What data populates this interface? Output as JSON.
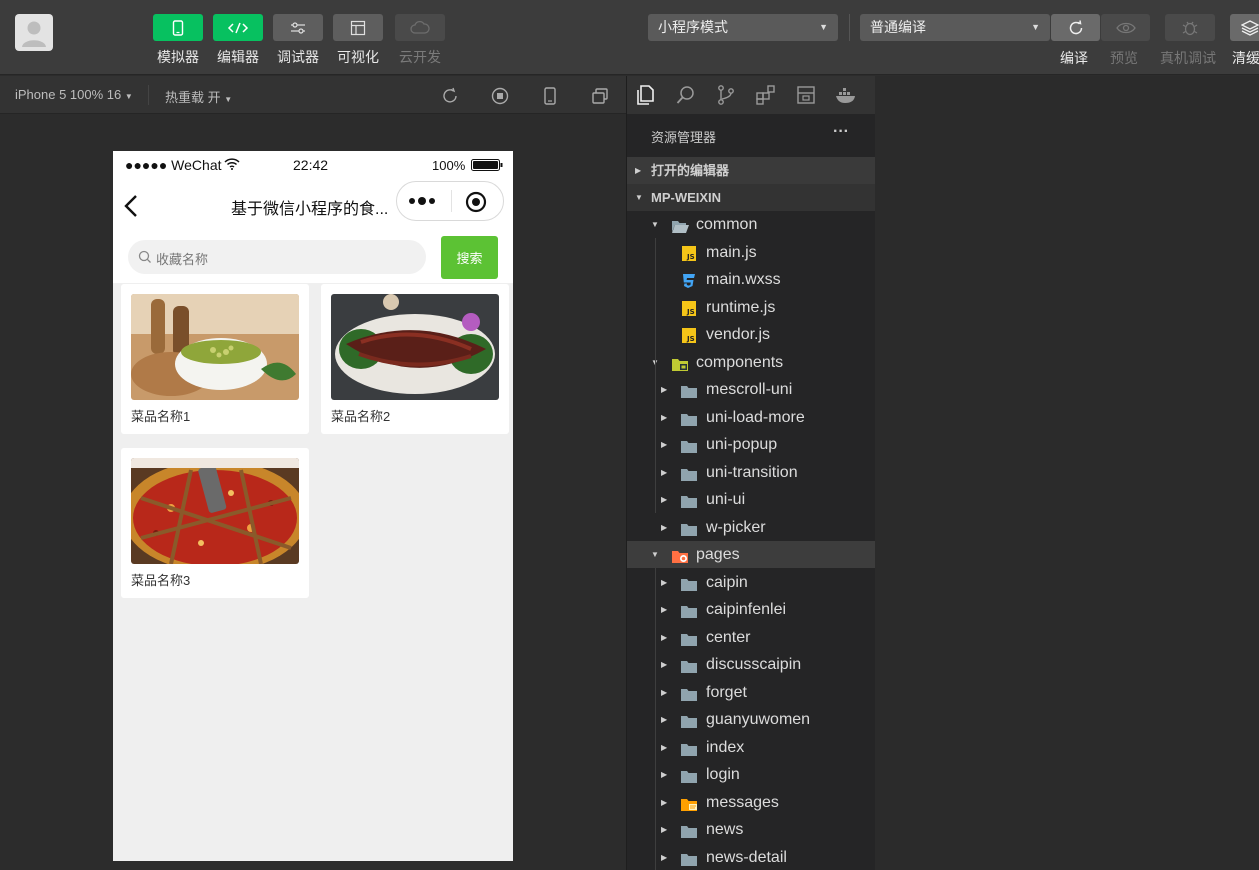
{
  "toolbar": {
    "simulator": "模拟器",
    "editor": "编辑器",
    "debugger": "调试器",
    "visual": "可视化",
    "cloud": "云开发",
    "mode_select": "小程序模式",
    "compile_select": "普通编译",
    "compile": "编译",
    "preview": "预览",
    "real_debug": "真机调试",
    "clear_cache": "清缓"
  },
  "simbar": {
    "device": "iPhone 5 100% 16",
    "hot_reload": "热重载 开"
  },
  "phone": {
    "status": {
      "carrier": "●●●●● WeChat",
      "time": "22:42",
      "battery": "100%"
    },
    "nav_title": "基于微信小程序的食...",
    "search_placeholder": "收藏名称",
    "search_button": "搜索",
    "cards": [
      {
        "name": "菜品名称1"
      },
      {
        "name": "菜品名称2"
      },
      {
        "name": "菜品名称3"
      }
    ]
  },
  "explorer": {
    "title": "资源管理器",
    "more": "···",
    "open_editors": "打开的编辑器",
    "project": "MP-WEIXIN",
    "tree": [
      {
        "name": "common",
        "level": 0,
        "type": "folder-open"
      },
      {
        "name": "main.js",
        "level": 1,
        "type": "js"
      },
      {
        "name": "main.wxss",
        "level": 1,
        "type": "css"
      },
      {
        "name": "runtime.js",
        "level": 1,
        "type": "js"
      },
      {
        "name": "vendor.js",
        "level": 1,
        "type": "js"
      },
      {
        "name": "components",
        "level": 0,
        "type": "folder-components"
      },
      {
        "name": "mescroll-uni",
        "level": 1,
        "type": "folder"
      },
      {
        "name": "uni-load-more",
        "level": 1,
        "type": "folder"
      },
      {
        "name": "uni-popup",
        "level": 1,
        "type": "folder"
      },
      {
        "name": "uni-transition",
        "level": 1,
        "type": "folder"
      },
      {
        "name": "uni-ui",
        "level": 1,
        "type": "folder"
      },
      {
        "name": "w-picker",
        "level": 1,
        "type": "folder"
      },
      {
        "name": "pages",
        "level": 0,
        "type": "folder-pages"
      },
      {
        "name": "caipin",
        "level": 1,
        "type": "folder"
      },
      {
        "name": "caipinfenlei",
        "level": 1,
        "type": "folder"
      },
      {
        "name": "center",
        "level": 1,
        "type": "folder"
      },
      {
        "name": "discusscaipin",
        "level": 1,
        "type": "folder"
      },
      {
        "name": "forget",
        "level": 1,
        "type": "folder"
      },
      {
        "name": "guanyuwomen",
        "level": 1,
        "type": "folder"
      },
      {
        "name": "index",
        "level": 1,
        "type": "folder"
      },
      {
        "name": "login",
        "level": 1,
        "type": "folder"
      },
      {
        "name": "messages",
        "level": 1,
        "type": "folder-messages"
      },
      {
        "name": "news",
        "level": 1,
        "type": "folder"
      },
      {
        "name": "news-detail",
        "level": 1,
        "type": "folder"
      }
    ]
  },
  "colors": {
    "accent_green": "#07c160",
    "search_green": "#5cc234",
    "js_icon": "#f5c518",
    "css_icon": "#42a5f5"
  }
}
